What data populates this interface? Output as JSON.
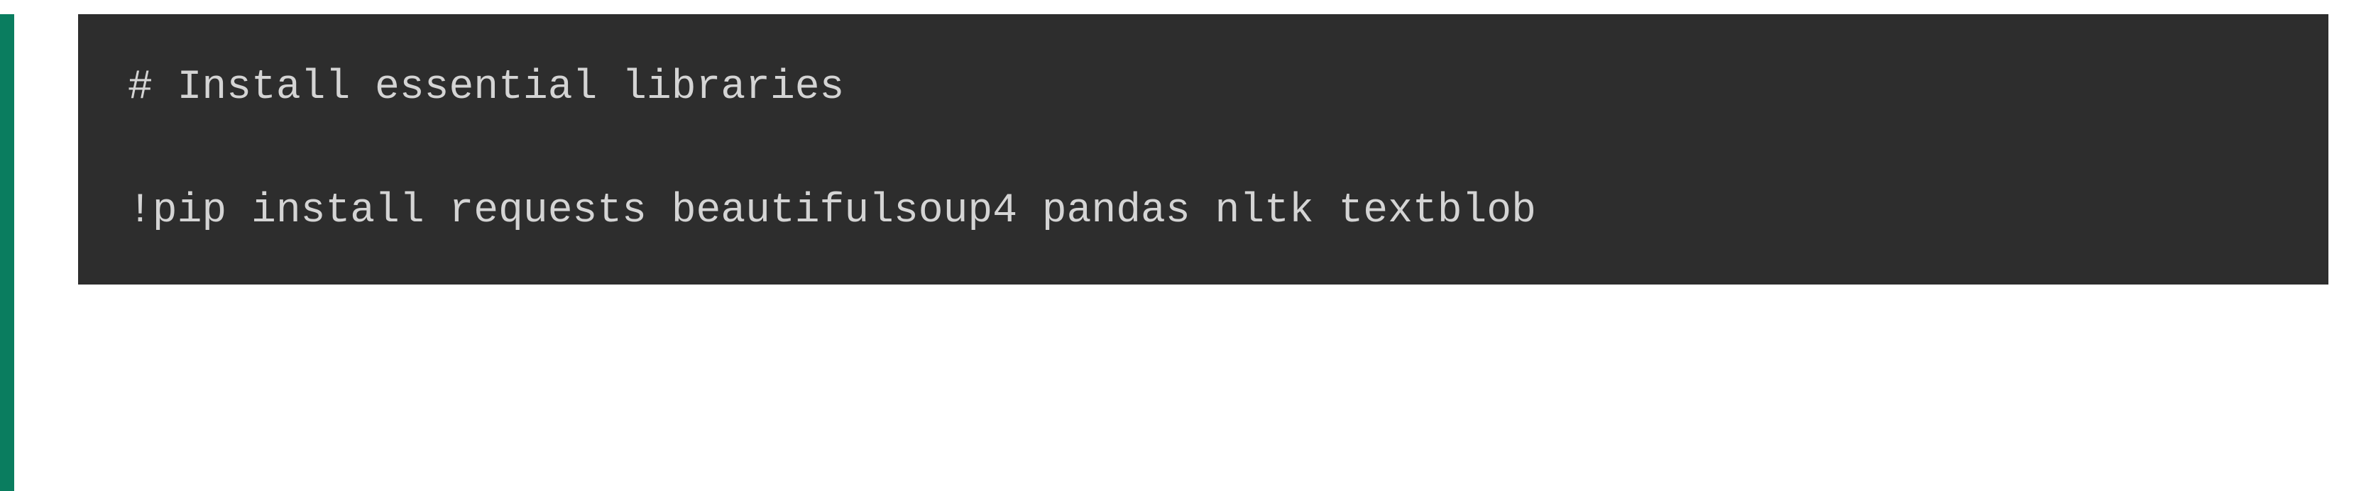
{
  "cell": {
    "accent_color": "#0a7d5f",
    "code": {
      "line1": "# Install essential libraries",
      "line2": "",
      "line3": "!pip install requests beautifulsoup4 pandas nltk textblob"
    }
  }
}
